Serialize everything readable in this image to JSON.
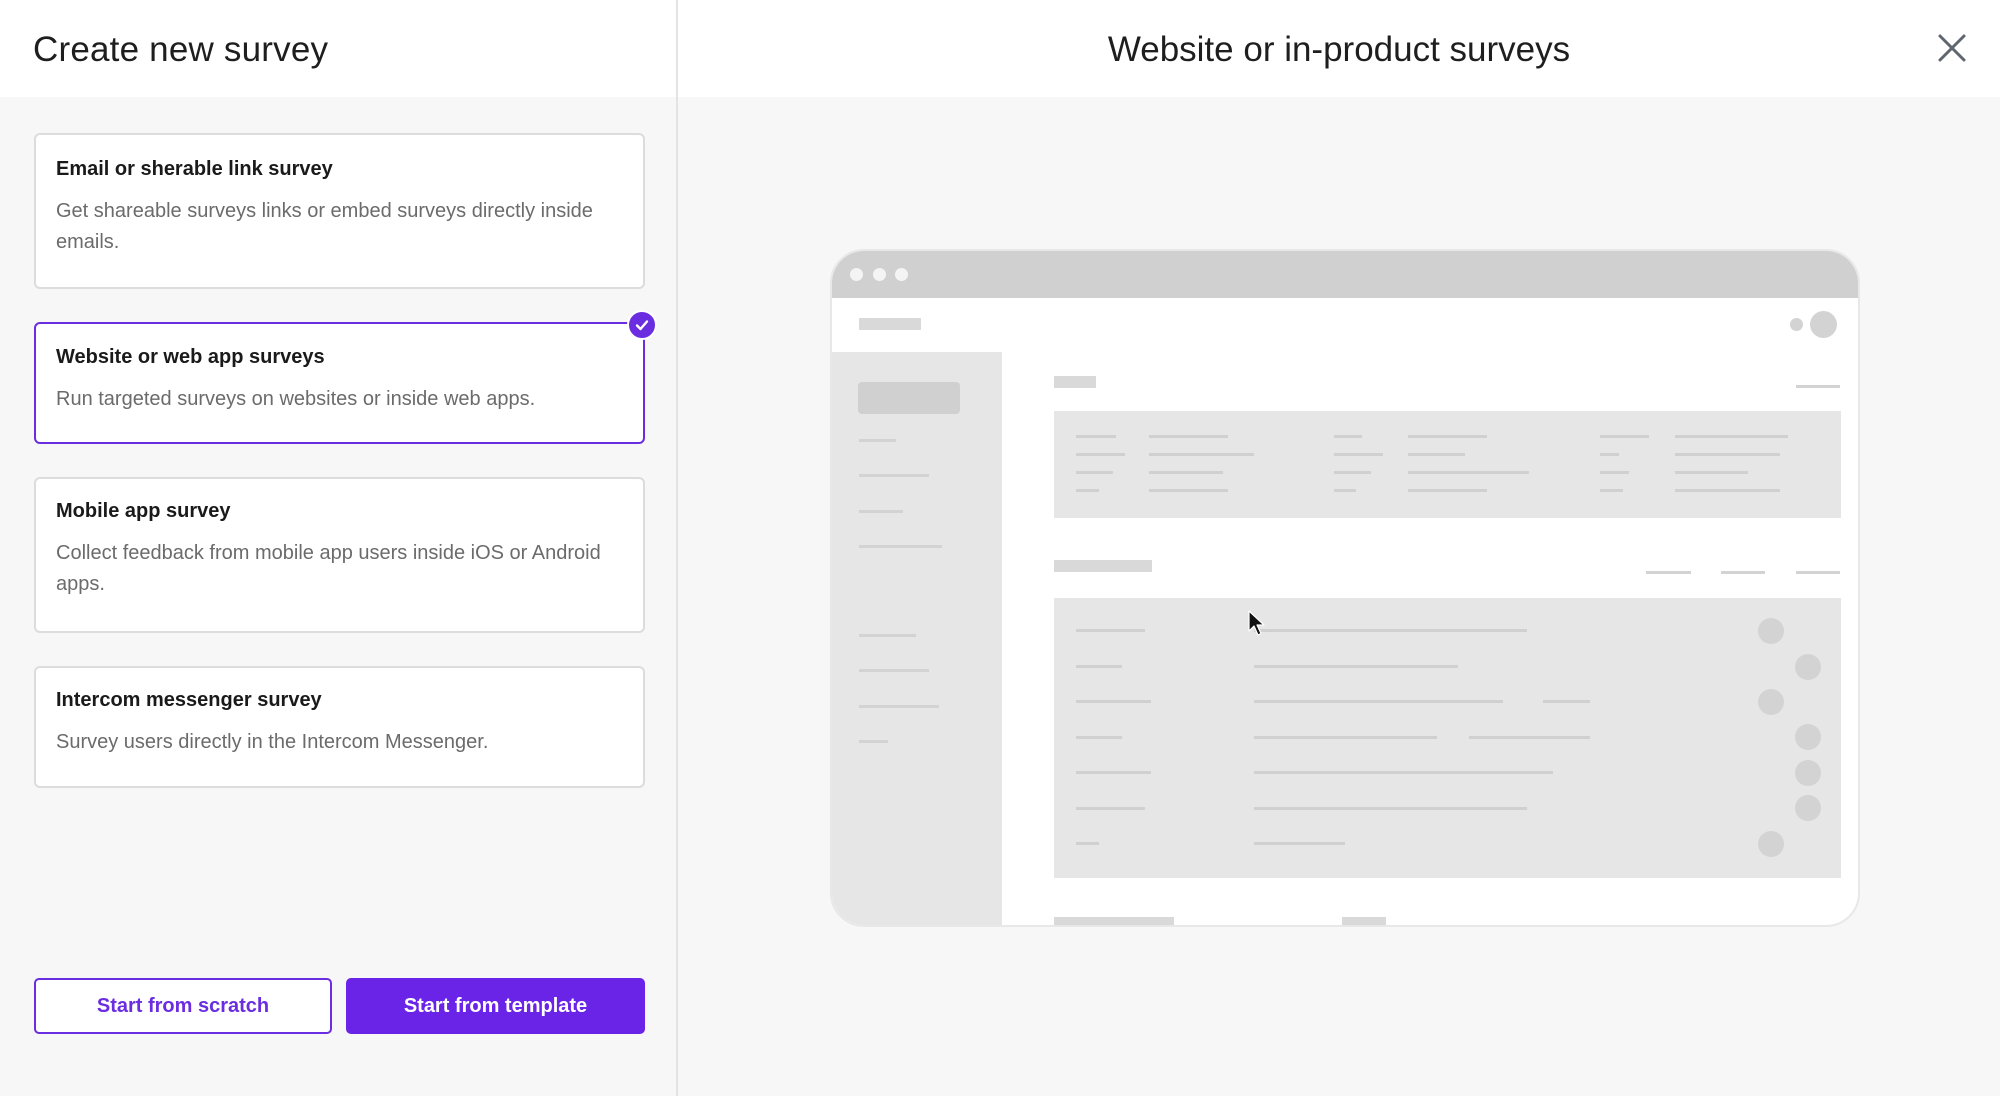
{
  "left": {
    "title": "Create new survey",
    "options": [
      {
        "title": "Email or sherable link survey",
        "description": "Get shareable surveys links or embed surveys directly inside emails.",
        "selected": false
      },
      {
        "title": "Website or web app surveys",
        "description": "Run targeted surveys on websites or inside web apps.",
        "selected": true
      },
      {
        "title": "Mobile app survey",
        "description": "Collect feedback from mobile app users inside iOS or Android apps.",
        "selected": false
      },
      {
        "title": "Intercom messenger survey",
        "description": "Survey users directly in the Intercom Messenger.",
        "selected": false
      }
    ],
    "buttons": {
      "scratch": "Start from scratch",
      "template": "Start from template"
    }
  },
  "right": {
    "title": "Website or in-product surveys"
  },
  "icons": {
    "close": "close-icon",
    "check": "check-icon",
    "cursor": "mouse-pointer-icon"
  },
  "colors": {
    "accent": "#6a2ee0",
    "accent_button": "#6a24e8",
    "background": "#f7f7f7"
  }
}
